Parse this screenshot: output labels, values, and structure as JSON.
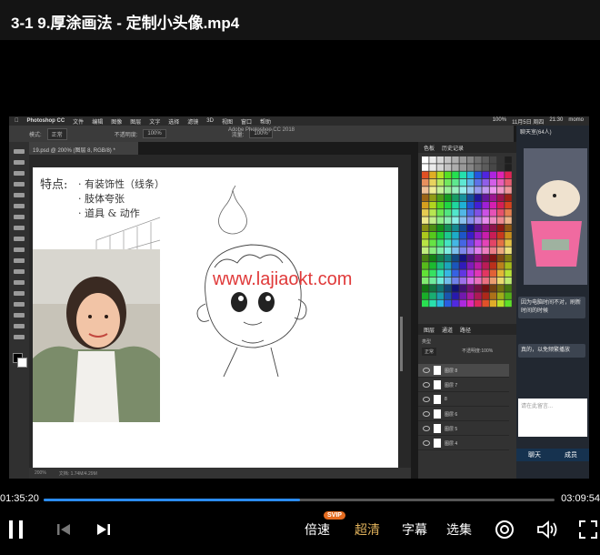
{
  "window": {
    "title": "3-1 9.厚涂画法 - 定制小头像.mp4"
  },
  "video_frame": {
    "mac_menubar": {
      "app_name": "Photoshop CC",
      "menus": [
        "文件",
        "编辑",
        "图像",
        "图层",
        "文字",
        "选择",
        "滤镜",
        "3D",
        "视图",
        "窗口",
        "帮助"
      ],
      "status_right": [
        "100%",
        "11月5日 周四",
        "21:30",
        "momo"
      ]
    },
    "ps_window_title": "Adobe Photoshop CC 2018",
    "options_bar": {
      "mode_label": "模式:",
      "mode_value": "正常",
      "opacity_label": "不透明度:",
      "opacity_value": "100%",
      "flow_label": "流量:",
      "flow_value": "100%"
    },
    "document_tab": "19.psd @ 200% (图层 8, RGB/8) *",
    "canvas": {
      "watermark": "www.lajiaokt.com",
      "notes": [
        "特点:",
        "· 有装饰性（线条）",
        "· 肢体夸张",
        "· 道具 & 动作"
      ]
    },
    "status_bar": {
      "zoom": "200%",
      "doc_size": "文档: 1.74M/4.29M"
    },
    "swatches_panel": {
      "tabs": [
        "色板",
        "历史记录"
      ]
    },
    "layers_panel": {
      "tabs": [
        "图层",
        "通道",
        "路径"
      ],
      "kind_label": "类型",
      "blend_mode": "正常",
      "opacity_label": "不透明度:",
      "opacity_value": "100%",
      "layers": [
        "图层 8",
        "图层 7",
        "8",
        "图层 6",
        "图层 5",
        "图层 4"
      ]
    },
    "chat_panel": {
      "header": "聊天室(64人)",
      "messages": [
        "因为电脑时间不对，刷新时间的时候",
        "真的，以免频繁播放"
      ],
      "input_placeholder": "请在此留言...",
      "tabs": [
        "聊天",
        "成员"
      ]
    }
  },
  "player": {
    "current_time": "01:35:20",
    "total_time": "03:09:54",
    "progress_fraction": 0.502,
    "controls": {
      "speed_label": "倍速",
      "speed_badge": "SVIP",
      "quality_label": "超清",
      "subtitle_label": "字幕",
      "episodes_label": "选集"
    }
  },
  "colors": {
    "progress_fill": "#2b8cf0",
    "quality_label": "#e0b25c",
    "badge": "#e56b1f"
  }
}
